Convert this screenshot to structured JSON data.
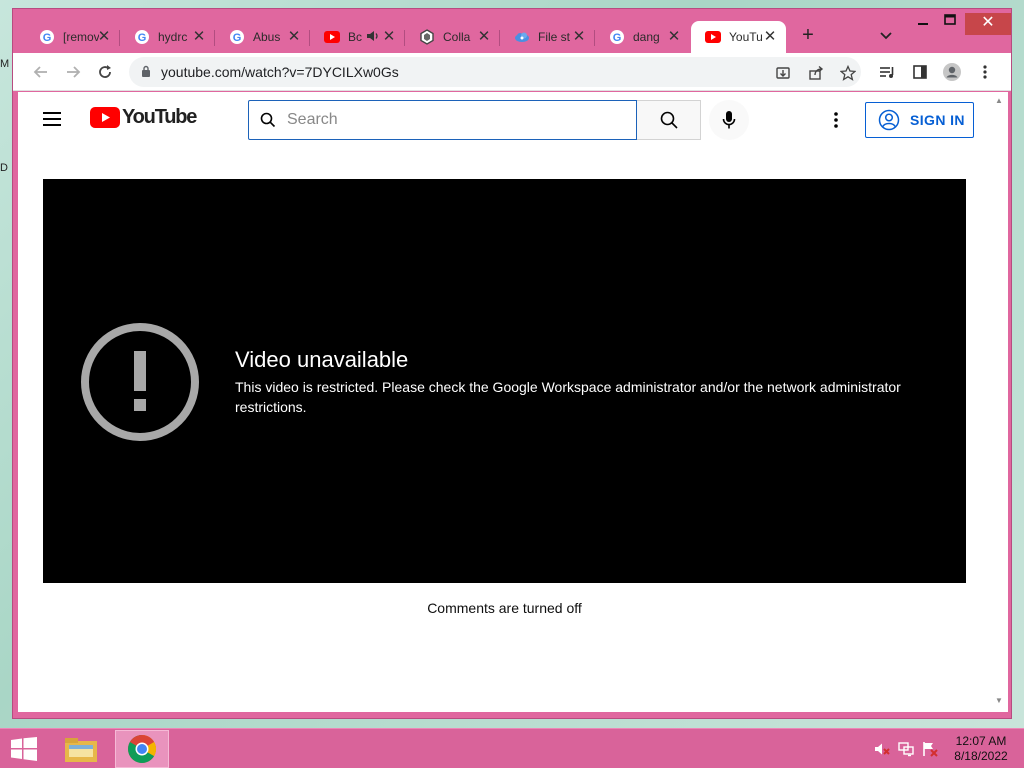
{
  "desktop": {
    "frag_1": "M",
    "frag_2": "D"
  },
  "browser": {
    "tabs": [
      {
        "title": "[removed]",
        "favicon": "google-g-icon",
        "active": false
      },
      {
        "title": "hydrc",
        "favicon": "google-g-icon",
        "active": false
      },
      {
        "title": "Abus",
        "favicon": "google-g-icon",
        "active": false
      },
      {
        "title": "Bc",
        "favicon": "youtube-icon",
        "active": false,
        "audio": true
      },
      {
        "title": "Colla",
        "favicon": "extension-icon",
        "active": false
      },
      {
        "title": "File st",
        "favicon": "cloud-icon",
        "active": false
      },
      {
        "title": "dang",
        "favicon": "google-g-icon",
        "active": false
      },
      {
        "title": "YouTu",
        "favicon": "youtube-icon",
        "active": true
      }
    ],
    "address": {
      "url": "youtube.com/watch?v=7DYCILXw0Gs"
    },
    "colors": {
      "frame": "#e0679f",
      "taskbar": "#d9639a"
    }
  },
  "youtube": {
    "logo_text": "YouTube",
    "search": {
      "placeholder": "Search",
      "value": ""
    },
    "signin_label": "SIGN IN",
    "player": {
      "title": "Video unavailable",
      "message": "This video is restricted. Please check the Google Workspace administrator and/or the network administrator restrictions."
    },
    "comments_status": "Comments are turned off",
    "colors": {
      "brand_red": "#ff0000",
      "link_blue": "#065fd4"
    }
  },
  "taskbar": {
    "items": [
      {
        "name": "file-explorer-icon",
        "active": false
      },
      {
        "name": "chrome-icon",
        "active": true
      }
    ],
    "clock": {
      "time": "12:07 AM",
      "date": "8/18/2022"
    }
  }
}
